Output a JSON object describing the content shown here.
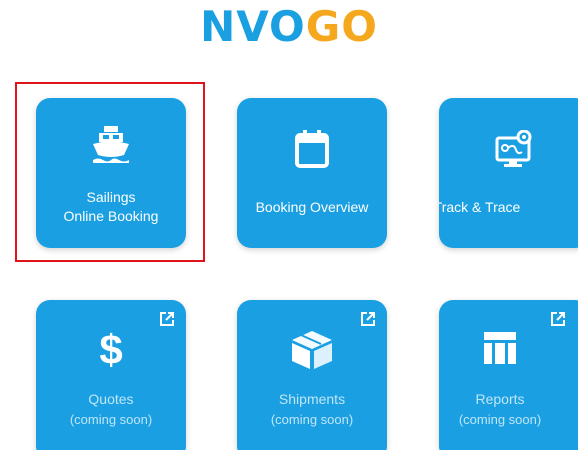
{
  "logo": {
    "part1": "NV",
    "part2": "O",
    "part3": "GO",
    "colors": {
      "blue": "#1a9fe0",
      "orange": "#f5a81e"
    }
  },
  "tiles": [
    {
      "icon": "ship-icon",
      "line1": "Sailings",
      "line2": "Online Booking"
    },
    {
      "icon": "calendar-icon",
      "line1": "Booking Overview"
    },
    {
      "icon": "map-route-icon",
      "line1": "Track & Trace"
    },
    {
      "icon": "dollar-icon",
      "line1": "Quotes",
      "line2": "(coming soon)",
      "external": "external-link-icon"
    },
    {
      "icon": "box-icon",
      "line1": "Shipments",
      "line2": "(coming soon)",
      "external": "external-link-icon"
    },
    {
      "icon": "table-icon",
      "line1": "Reports",
      "line2": "(coming soon)",
      "external": "external-link-icon"
    }
  ],
  "colors": {
    "tile": "#1aa0e2",
    "selection": "#e0151b"
  }
}
